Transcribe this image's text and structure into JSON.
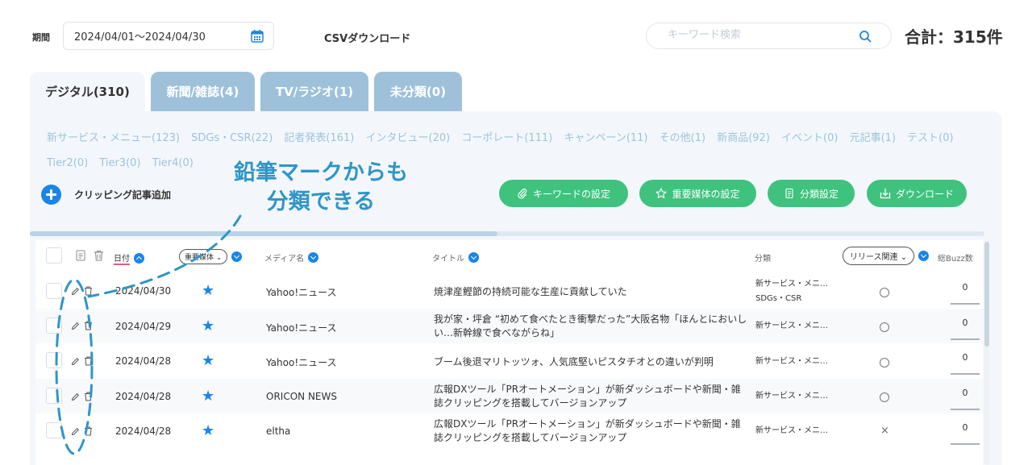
{
  "filter": {
    "period_label": "期間",
    "period_value": "2024/04/01〜2024/04/30",
    "csv_label": "CSVダウンロード",
    "search_placeholder": "キーワード検索",
    "total": "合計：315件"
  },
  "tabs": [
    {
      "label": "デジタル(310)",
      "active": true
    },
    {
      "label": "新聞/雑誌(4)",
      "active": false
    },
    {
      "label": "TV/ラジオ(1)",
      "active": false
    },
    {
      "label": "未分類(0)",
      "active": false
    }
  ],
  "categories_row1": [
    "新サービス・メニュー(123)",
    "SDGs・CSR(22)",
    "記者発表(161)",
    "インタビュー(20)",
    "コーポレート(111)",
    "キャンペーン(11)",
    "その他(1)",
    "新商品(92)",
    "イベント(0)",
    "元記事(1)",
    "テスト(0)"
  ],
  "categories_row2": [
    "Tier2(0)",
    "Tier3(0)",
    "Tier4(0)"
  ],
  "actions": {
    "add_clipping": "クリッピング記事追加",
    "keyword_settings": "キーワードの設定",
    "important_media_settings": "重要媒体の設定",
    "category_settings": "分類設定",
    "download": "ダウンロード"
  },
  "annotation": {
    "line1": "鉛筆マークからも",
    "line2": "分類できる"
  },
  "table": {
    "headers": {
      "date": "日付",
      "important_media": "重要媒体",
      "media_name": "メディア名",
      "title": "タイトル",
      "category": "分類",
      "release_filter": "リリース関連",
      "buzz": "総Buzz数"
    },
    "rows": [
      {
        "date": "2024/04/30",
        "media": "Yahoo!ニュース",
        "title": "焼津産鰹節の持続可能な生産に貢献していた",
        "cat1": "新サービス・メニ…",
        "cat2": "SDGs・CSR",
        "release": "circle",
        "buzz": "0"
      },
      {
        "date": "2024/04/29",
        "media": "Yahoo!ニュース",
        "title": "我が家・坪倉 “初めて食べたとき衝撃だった”大阪名物「ほんとにおいしい…新幹線で食べながらね」",
        "cat1": "新サービス・メニ…",
        "cat2": "",
        "release": "circle",
        "buzz": "0"
      },
      {
        "date": "2024/04/28",
        "media": "Yahoo!ニュース",
        "title": "ブーム後退マリトッツォ、人気底堅いピスタチオとの違いが判明",
        "cat1": "新サービス・メニ…",
        "cat2": "",
        "release": "circle",
        "buzz": "0"
      },
      {
        "date": "2024/04/28",
        "media": "ORICON NEWS",
        "title": "広報DXツール「PRオートメーション」が新ダッシュボードや新聞・雑誌クリッピングを搭載してバージョンアップ",
        "cat1": "新サービス・メニ…",
        "cat2": "",
        "release": "circle",
        "buzz": "0"
      },
      {
        "date": "2024/04/28",
        "media": "eltha",
        "title": "広報DXツール「PRオートメーション」が新ダッシュボードや新聞・雑誌クリッピングを搭載してバージョンアップ",
        "cat1": "新サービス・メニ…",
        "cat2": "",
        "release": "cross",
        "buzz": "0"
      }
    ]
  },
  "colors": {
    "accent_blue": "#1a85e8",
    "green": "#3fc27e",
    "tab_inactive": "#9ec1d9",
    "category_text": "#9dc3da",
    "annotation": "#2f95c8"
  }
}
